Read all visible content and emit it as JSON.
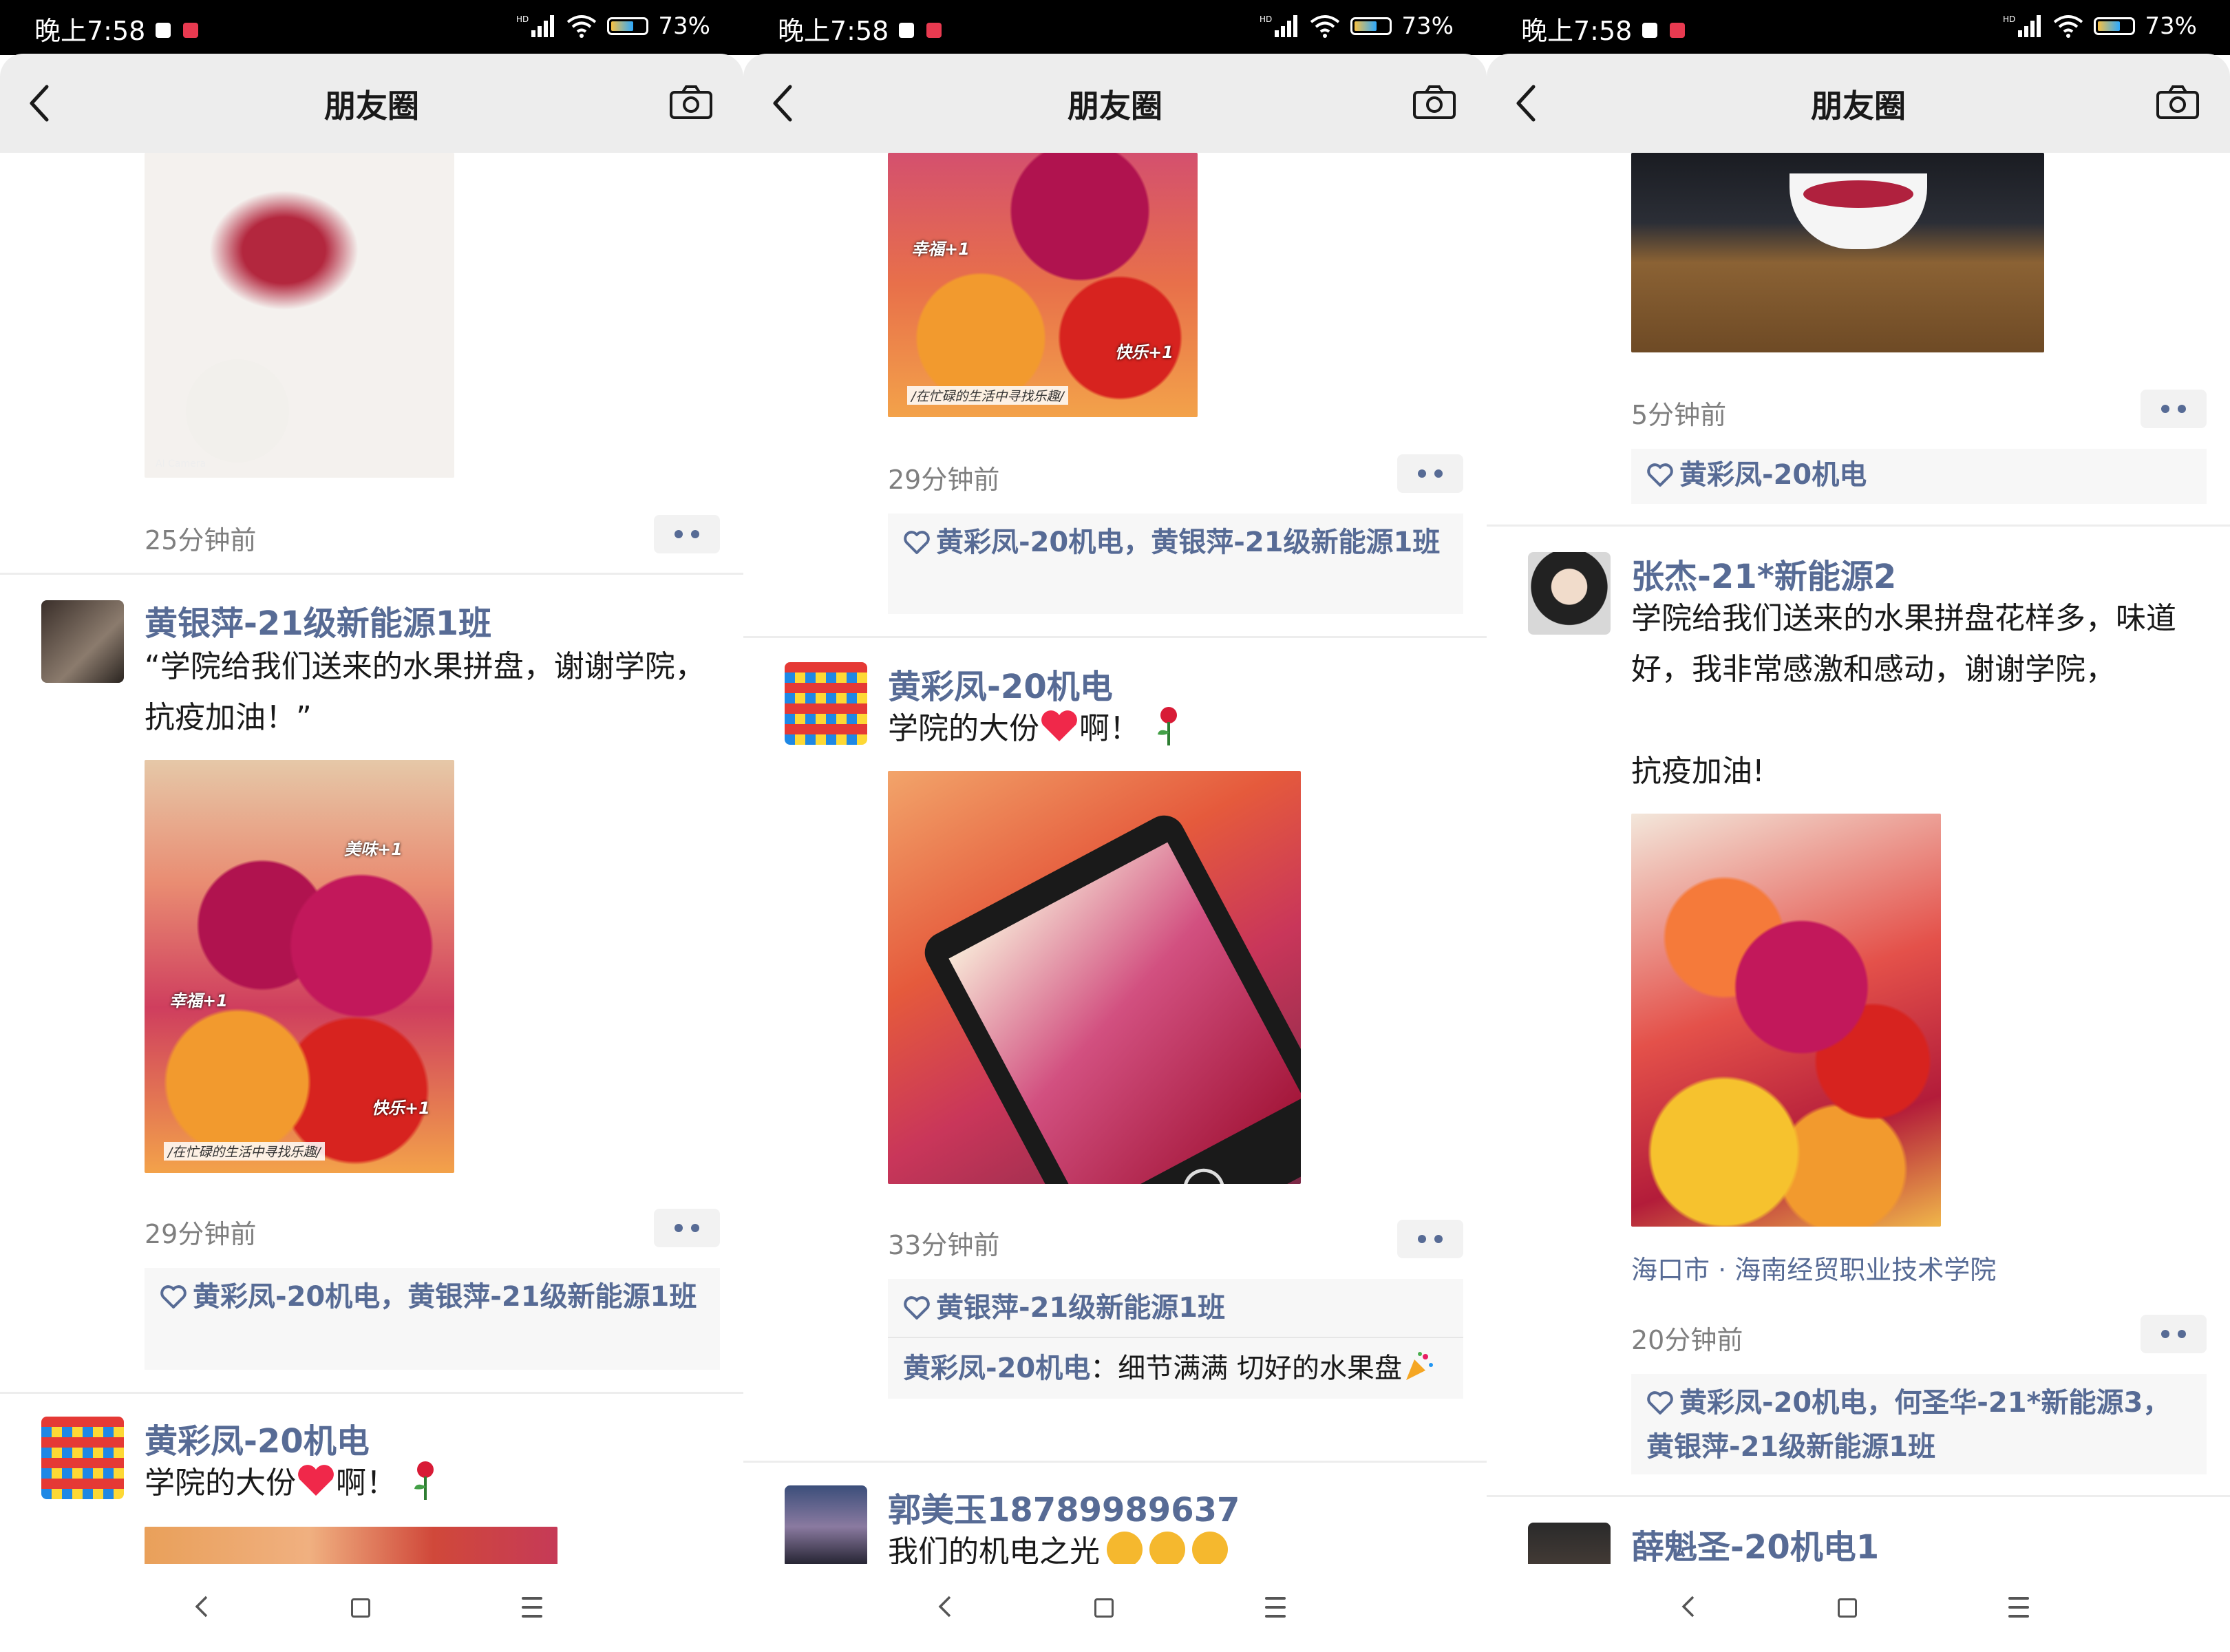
{
  "status": {
    "time": "晚上7:58",
    "battery": "73%"
  },
  "nav": {
    "title": "朋友圈"
  },
  "panels": [
    {
      "posts": [
        {
          "time": "25分钟前"
        },
        {
          "author": "黄银萍-21级新能源1班",
          "text": "“学院给我们送来的水果拼盘，谢谢学院，抗疫加油！”",
          "captions": [
            "美味+1",
            "幸福+1",
            "快乐+1"
          ],
          "strip": "/在忙碌的生活中寻找乐趣/",
          "time": "29分钟前",
          "likes": "黄彩凤-20机电，黄银萍-21级新能源1班"
        },
        {
          "author": "黄彩凤-20机电",
          "text_before": "学院的大份",
          "text_after": "啊！"
        }
      ]
    },
    {
      "posts": [
        {
          "captions": [
            "幸福+1",
            "快乐+1"
          ],
          "strip": "/在忙碌的生活中寻找乐趣/",
          "time": "29分钟前",
          "likes": "黄彩凤-20机电，黄银萍-21级新能源1班"
        },
        {
          "author": "黄彩凤-20机电",
          "text_before": "学院的大份",
          "text_after": "啊！",
          "time": "33分钟前",
          "likes": "黄银萍-21级新能源1班",
          "comment_author": "黄彩凤-20机电",
          "comment_text": "细节满满 切好的水果盘"
        },
        {
          "author": "郭美玉18789989637",
          "text": "我们的机电之光"
        }
      ]
    },
    {
      "posts": [
        {
          "time": "5分钟前",
          "likes": "黄彩凤-20机电"
        },
        {
          "author": "张杰-21*新能源2",
          "text": "学院给我们送来的水果拼盘花样多，味道好，我非常感激和感动，谢谢学院，",
          "text2": "抗疫加油!",
          "location": "海口市 · 海南经贸职业技术学院",
          "time": "20分钟前",
          "likes": "黄彩凤-20机电，何圣华-21*新能源3，黄银萍-21级新能源1班"
        },
        {
          "author": "薛魁圣-20机电1"
        }
      ]
    }
  ],
  "icons": {
    "back": "back-arrow-icon",
    "camera": "camera-icon",
    "heart": "heart-outline-icon"
  },
  "colors": {
    "link": "#576b95",
    "navbar": "#ededed",
    "statusbar": "#000000"
  }
}
